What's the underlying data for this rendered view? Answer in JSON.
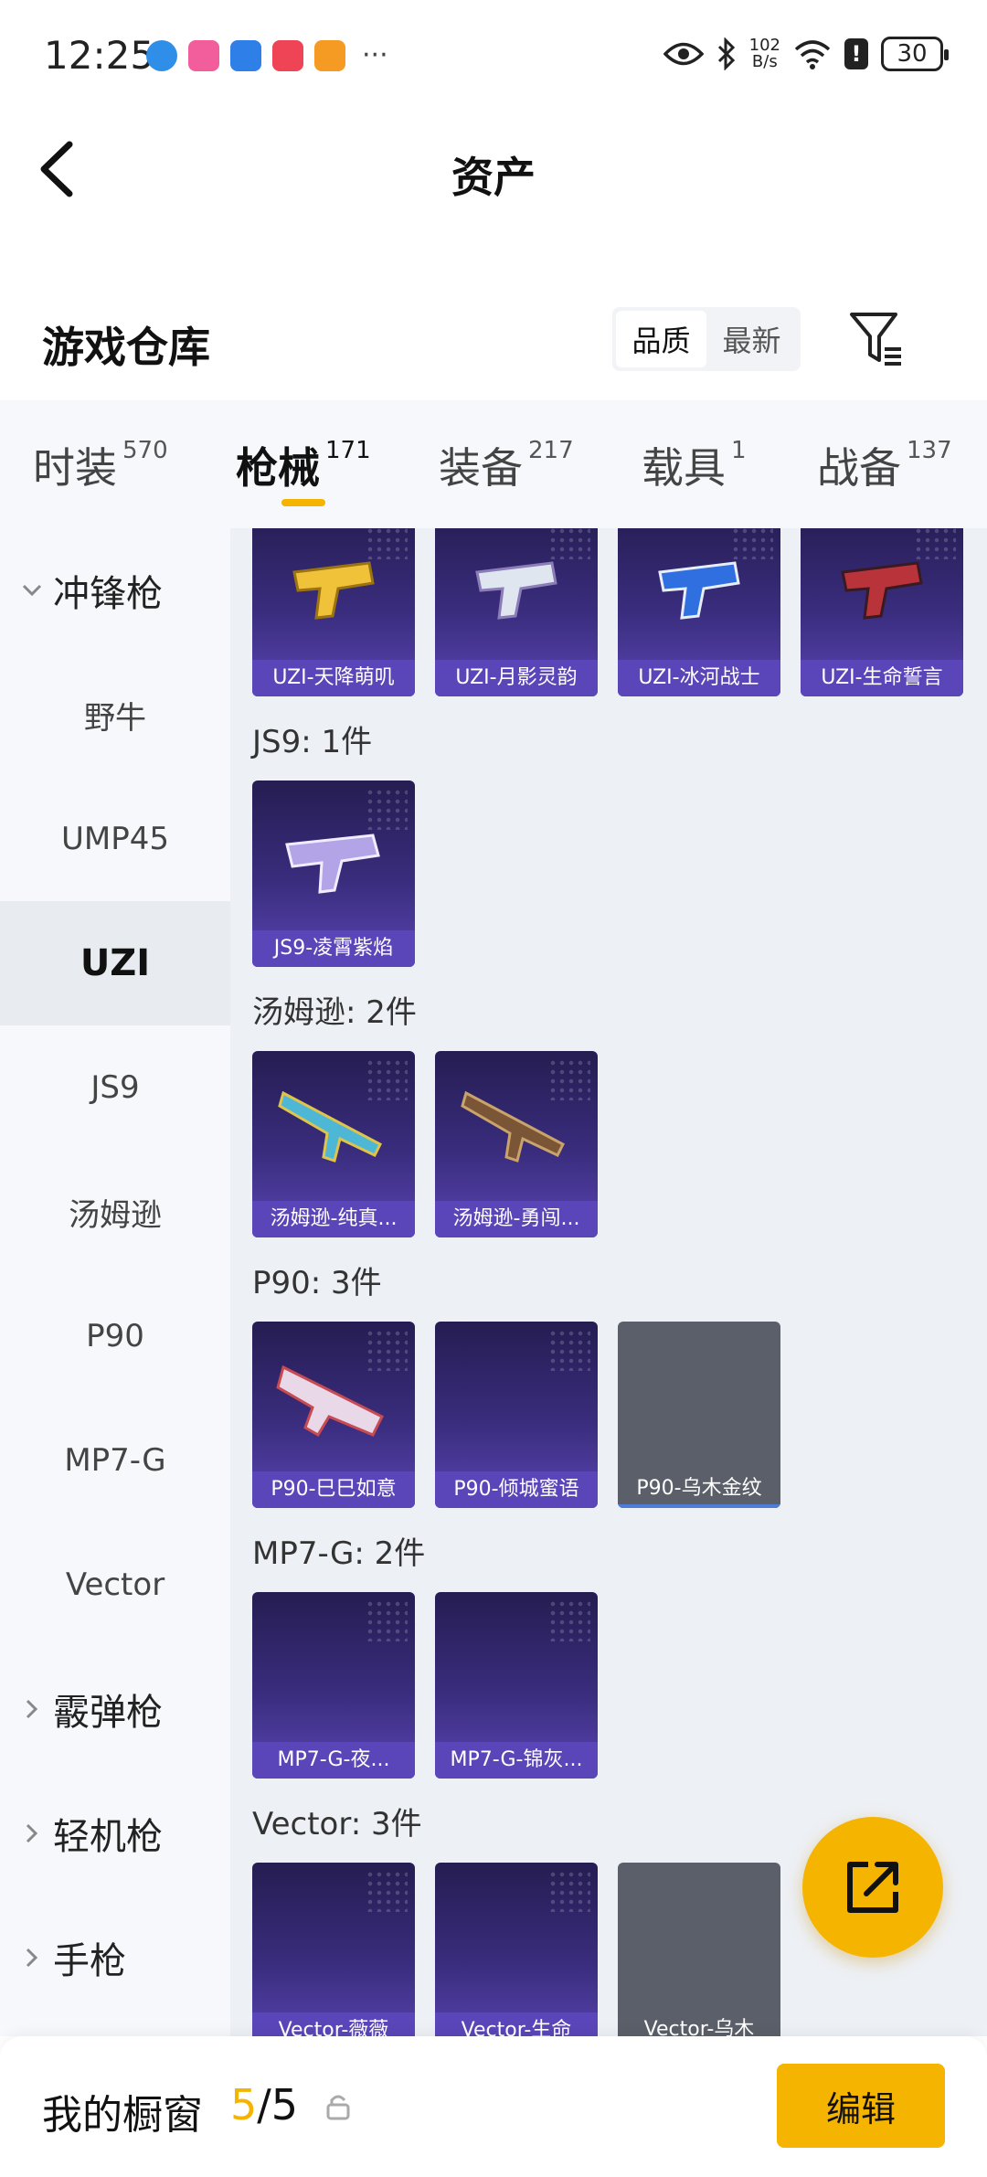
{
  "status_bar": {
    "time": "12:25",
    "more": "···",
    "speed_top": "102",
    "speed_bottom": "B/s",
    "battery": "30",
    "alert": "!"
  },
  "nav": {
    "title": "资产"
  },
  "section": {
    "title": "游戏仓库",
    "sort_options": [
      "品质",
      "最新"
    ],
    "active_sort": "品质"
  },
  "tabs": [
    {
      "label": "时装",
      "count": "570"
    },
    {
      "label": "枪械",
      "count": "171"
    },
    {
      "label": "装备",
      "count": "217"
    },
    {
      "label": "载具",
      "count": "1"
    },
    {
      "label": "战备",
      "count": "137"
    }
  ],
  "sidebar": {
    "group_open": "冲锋枪",
    "items": [
      "野牛",
      "UMP45",
      "UZI",
      "JS9",
      "汤姆逊",
      "P90",
      "MP7-G",
      "Vector"
    ],
    "active_item": "UZI",
    "groups_closed": [
      "霰弹枪",
      "轻机枪",
      "手枪"
    ]
  },
  "content": {
    "uzi_cards": [
      "UZI-天降萌叽",
      "UZI-月影灵韵",
      "UZI-冰河战士",
      "UZI-生命誓言"
    ],
    "groups": [
      {
        "label": "JS9: 1件",
        "cards": [
          "JS9-凌霄紫焰"
        ]
      },
      {
        "label": "汤姆逊: 2件",
        "cards": [
          "汤姆逊-纯真...",
          "汤姆逊-勇闯..."
        ]
      },
      {
        "label": "P90: 3件",
        "cards": [
          "P90-巳巳如意",
          "P90-倾城蜜语",
          "P90-乌木金纹"
        ]
      },
      {
        "label": "MP7-G: 2件",
        "cards": [
          "MP7-G-夜...",
          "MP7-G-锦灰..."
        ]
      },
      {
        "label": "Vector: 3件",
        "cards": [
          "Vector-薇薇",
          "Vector-生命",
          "Vector-乌木"
        ]
      }
    ]
  },
  "bottom": {
    "label": "我的橱窗",
    "current": "5",
    "sep_total": "/5",
    "edit": "编辑"
  },
  "colors": {
    "accent": "#f5b400",
    "card_top": "#251d52",
    "card_caption": "#5a46b8",
    "card_grey": "#5b5f69"
  }
}
